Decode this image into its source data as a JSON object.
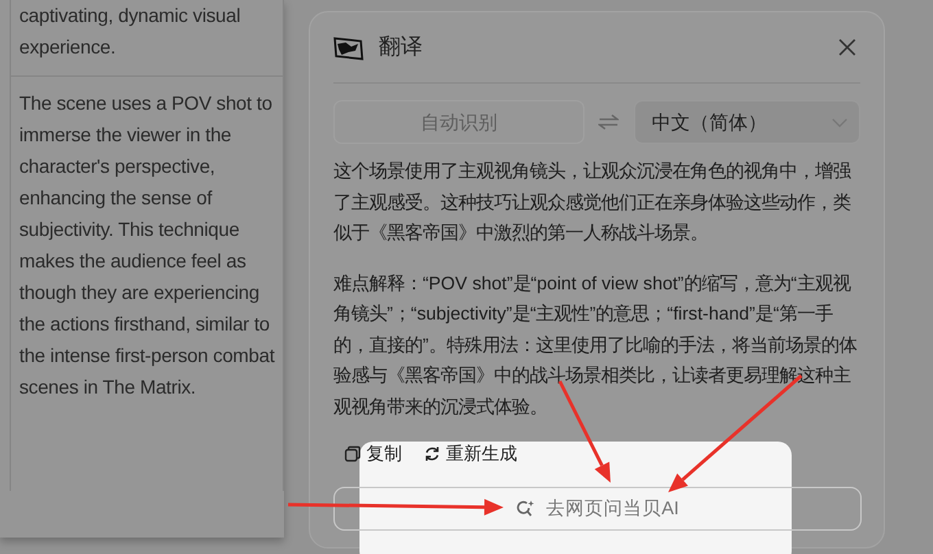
{
  "left_panel": {
    "cells": [
      {
        "text": "captivating, dynamic visual experience."
      },
      {
        "text": "The scene uses a POV shot to immerse the viewer in the character's perspective, enhancing the sense of subjectivity. This technique makes the audience feel as though they are experiencing the actions firsthand, similar to the intense first-person combat scenes in The Matrix."
      }
    ]
  },
  "dialog": {
    "title": "翻译",
    "source_language": {
      "label": "自动识别",
      "disabled": true
    },
    "target_language": {
      "label": "中文（简体）",
      "disabled": false
    },
    "paragraphs": [
      "这个场景使用了主观视角镜头，让观众沉浸在角色的视角中，增强了主观感受。这种技巧让观众感觉他们正在亲身体验这些动作，类似于《黑客帝国》中激烈的第一人称战斗场景。",
      "难点解释：“POV shot”是“point of view shot”的缩写，意为“主观视角镜头”；“subjectivity”是“主观性”的意思；“first-hand”是“第一手的，直接的”。特殊用法：这里使用了比喻的手法，将当前场景的体验感与《黑客帝国》中的战斗场景相类比，让读者更易理解这种主观视角带来的沉浸式体验。"
    ],
    "actions": [
      {
        "kind": "copy",
        "label": "复制"
      },
      {
        "kind": "regenerate",
        "label": "重新生成"
      }
    ],
    "ask_button": {
      "label": "去网页问当贝AI",
      "highlighted": true
    }
  }
}
